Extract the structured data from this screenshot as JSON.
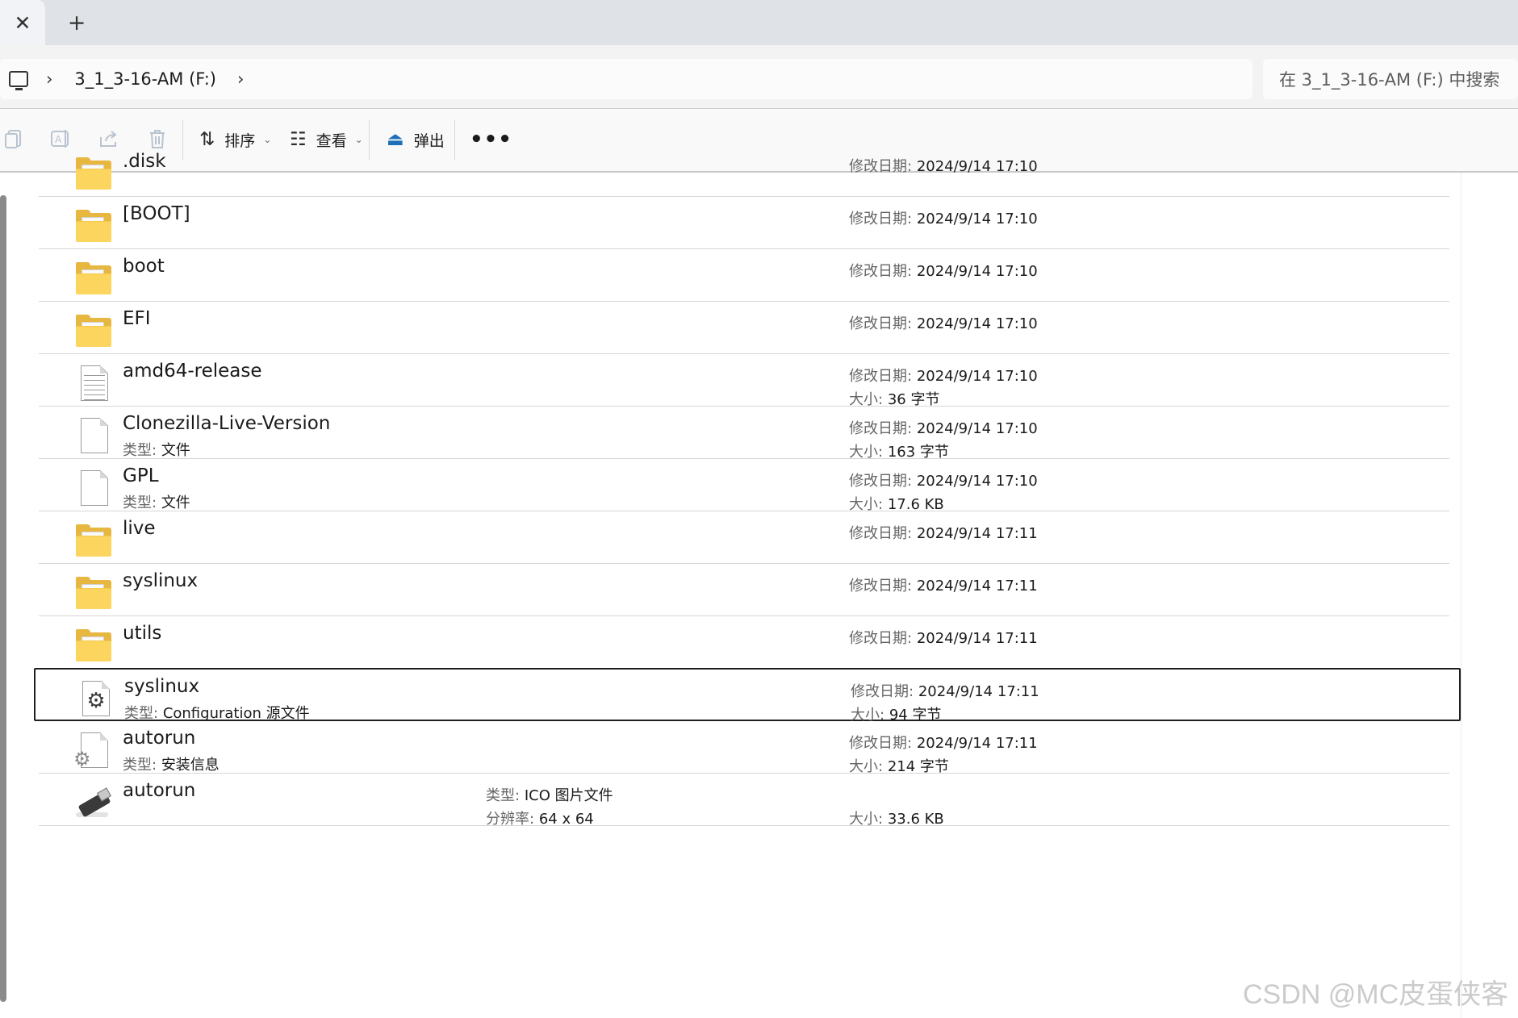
{
  "tabs": {
    "close_glyph": "✕",
    "new_glyph": "+"
  },
  "address": {
    "crumb": "3_1_3-16-AM (F:)",
    "search_placeholder": "在 3_1_3-16-AM (F:) 中搜索"
  },
  "toolbar": {
    "icons": [
      "copy-icon",
      "rename-icon",
      "share-icon",
      "delete-icon"
    ],
    "sort_label": "排序",
    "view_label": "查看",
    "eject_label": "弹出",
    "more_label": "•••"
  },
  "labels": {
    "modified": "修改日期:",
    "size": "大小:",
    "type": "类型:",
    "resolution": "分辨率:"
  },
  "files": [
    {
      "name": ".disk",
      "icon": "folder-icon",
      "modified": "2024/9/14 17:10"
    },
    {
      "name": "[BOOT]",
      "icon": "folder-icon",
      "modified": "2024/9/14 17:10"
    },
    {
      "name": "boot",
      "icon": "folder-icon",
      "modified": "2024/9/14 17:10"
    },
    {
      "name": "EFI",
      "icon": "folder-icon",
      "modified": "2024/9/14 17:10"
    },
    {
      "name": "amd64-release",
      "icon": "text-file-icon",
      "modified": "2024/9/14 17:10",
      "size": "36 字节"
    },
    {
      "name": "Clonezilla-Live-Version",
      "icon": "file-icon",
      "type": "文件",
      "modified": "2024/9/14 17:10",
      "size": "163 字节"
    },
    {
      "name": "GPL",
      "icon": "file-icon",
      "type": "文件",
      "modified": "2024/9/14 17:10",
      "size": "17.6 KB"
    },
    {
      "name": "live",
      "icon": "folder-icon",
      "modified": "2024/9/14 17:11"
    },
    {
      "name": "syslinux",
      "icon": "folder-icon",
      "modified": "2024/9/14 17:11"
    },
    {
      "name": "utils",
      "icon": "folder-icon",
      "modified": "2024/9/14 17:11"
    },
    {
      "name": "syslinux",
      "icon": "config-file-icon",
      "type": "Configuration 源文件",
      "modified": "2024/9/14 17:11",
      "size": "94 字节",
      "selected": true
    },
    {
      "name": "autorun",
      "icon": "setup-info-icon",
      "type": "安装信息",
      "modified": "2024/9/14 17:11",
      "size": "214 字节"
    },
    {
      "name": "autorun",
      "icon": "usb-drive-icon",
      "ico_type": "ICO 图片文件",
      "resolution": "64 x 64",
      "size": "33.6 KB"
    }
  ],
  "watermark": "CSDN @MC皮蛋侠客"
}
